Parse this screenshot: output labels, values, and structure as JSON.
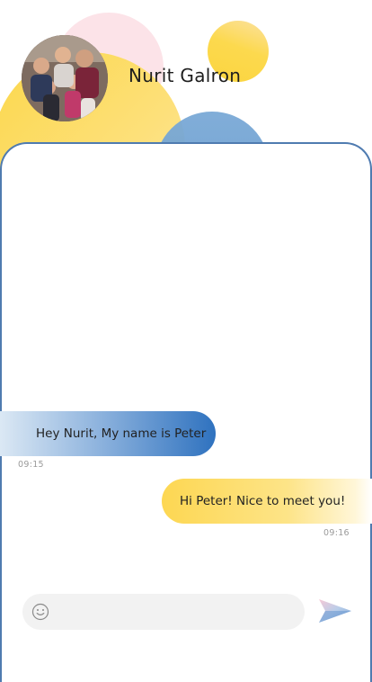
{
  "header": {
    "contact_name": "Nurit Galron",
    "avatar_icon": "group-photo-avatar"
  },
  "messages": [
    {
      "direction": "incoming",
      "text": "Hey Nurit, My name is Peter",
      "time": "09:15"
    },
    {
      "direction": "outgoing",
      "text": "Hi Peter! Nice to meet you!",
      "time": "09:16"
    }
  ],
  "composer": {
    "placeholder": "",
    "emoji_icon": "smiley-icon",
    "send_icon": "paper-plane-send-icon"
  },
  "colors": {
    "accent_blue": "#2f72bf",
    "accent_yellow": "#fdd752",
    "panel_border": "#4f7bb0",
    "decor_pink": "#fce3e8"
  }
}
